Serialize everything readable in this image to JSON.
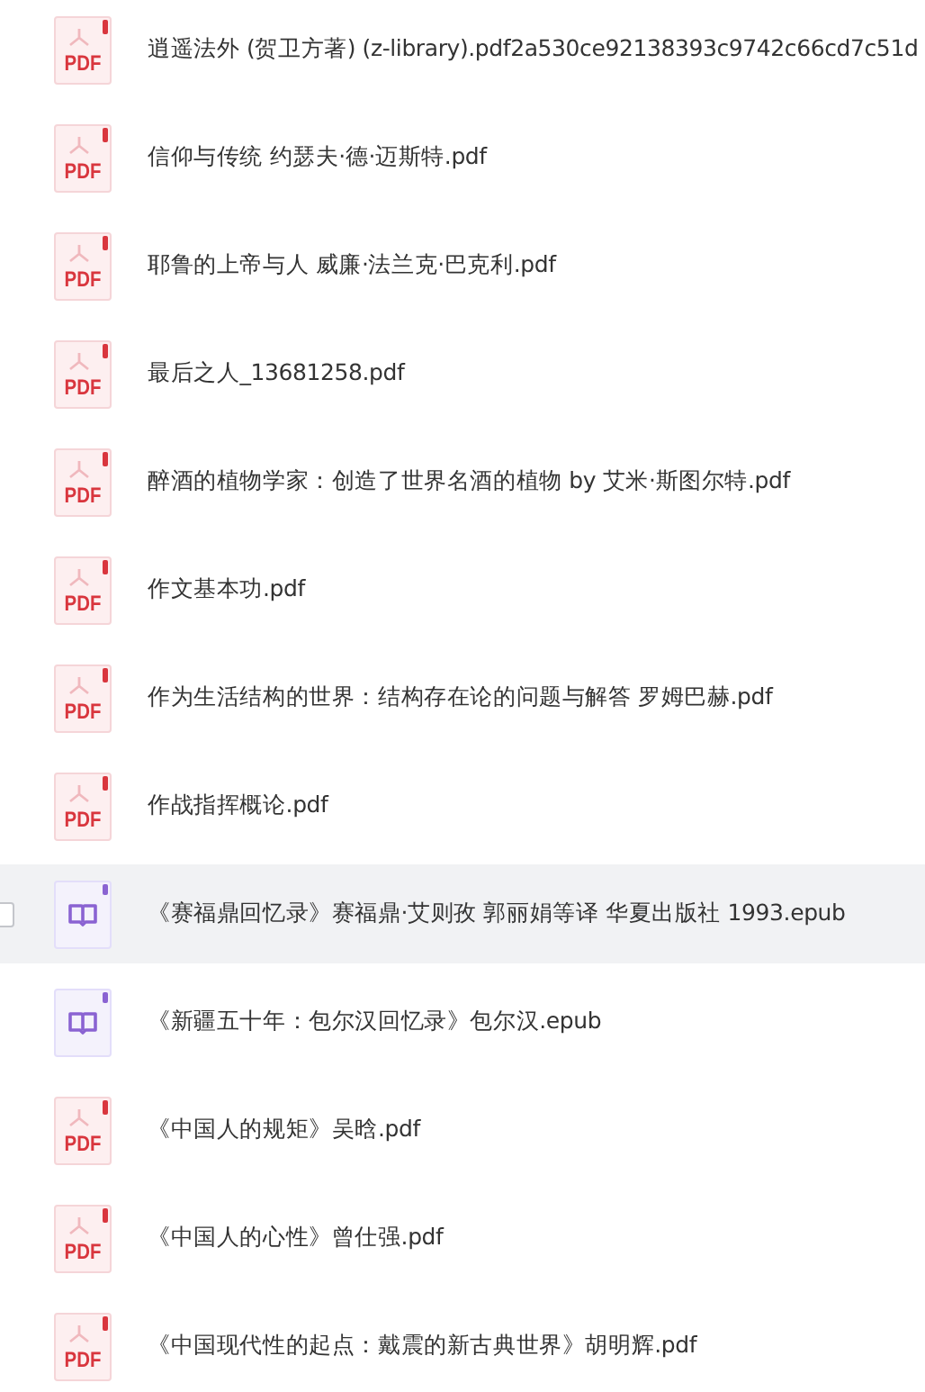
{
  "files": [
    {
      "kind": "pdf",
      "badge": "PDF",
      "name": "逍遥法外 (贺卫方著) (z-library).pdf2a530ce92138393c9742c66cd7c51d",
      "hovered": false,
      "checked": false
    },
    {
      "kind": "pdf",
      "badge": "PDF",
      "name": "信仰与传统 约瑟夫·德·迈斯特.pdf",
      "hovered": false,
      "checked": false
    },
    {
      "kind": "pdf",
      "badge": "PDF",
      "name": "耶鲁的上帝与人 威廉·法兰克·巴克利.pdf",
      "hovered": false,
      "checked": false
    },
    {
      "kind": "pdf",
      "badge": "PDF",
      "name": "最后之人_13681258.pdf",
      "hovered": false,
      "checked": false
    },
    {
      "kind": "pdf",
      "badge": "PDF",
      "name": "醉酒的植物学家：创造了世界名酒的植物 by 艾米·斯图尔特.pdf",
      "hovered": false,
      "checked": false
    },
    {
      "kind": "pdf",
      "badge": "PDF",
      "name": "作文基本功.pdf",
      "hovered": false,
      "checked": false
    },
    {
      "kind": "pdf",
      "badge": "PDF",
      "name": "作为生活结构的世界：结构存在论的问题与解答 罗姆巴赫.pdf",
      "hovered": false,
      "checked": false
    },
    {
      "kind": "pdf",
      "badge": "PDF",
      "name": "作战指挥概论.pdf",
      "hovered": false,
      "checked": false
    },
    {
      "kind": "epub",
      "name": "《赛福鼎回忆录》赛福鼎·艾则孜 郭丽娟等译 华夏出版社 1993.epub",
      "hovered": true,
      "checked": false
    },
    {
      "kind": "epub",
      "name": "《新疆五十年：包尔汉回忆录》包尔汉.epub",
      "hovered": false,
      "checked": false
    },
    {
      "kind": "pdf",
      "badge": "PDF",
      "name": "《中国人的规矩》吴晗.pdf",
      "hovered": false,
      "checked": false
    },
    {
      "kind": "pdf",
      "badge": "PDF",
      "name": "《中国人的心性》曾仕强.pdf",
      "hovered": false,
      "checked": false
    },
    {
      "kind": "pdf",
      "badge": "PDF",
      "name": "《中国现代性的起点：戴震的新古典世界》胡明辉.pdf",
      "hovered": false,
      "checked": false
    }
  ]
}
